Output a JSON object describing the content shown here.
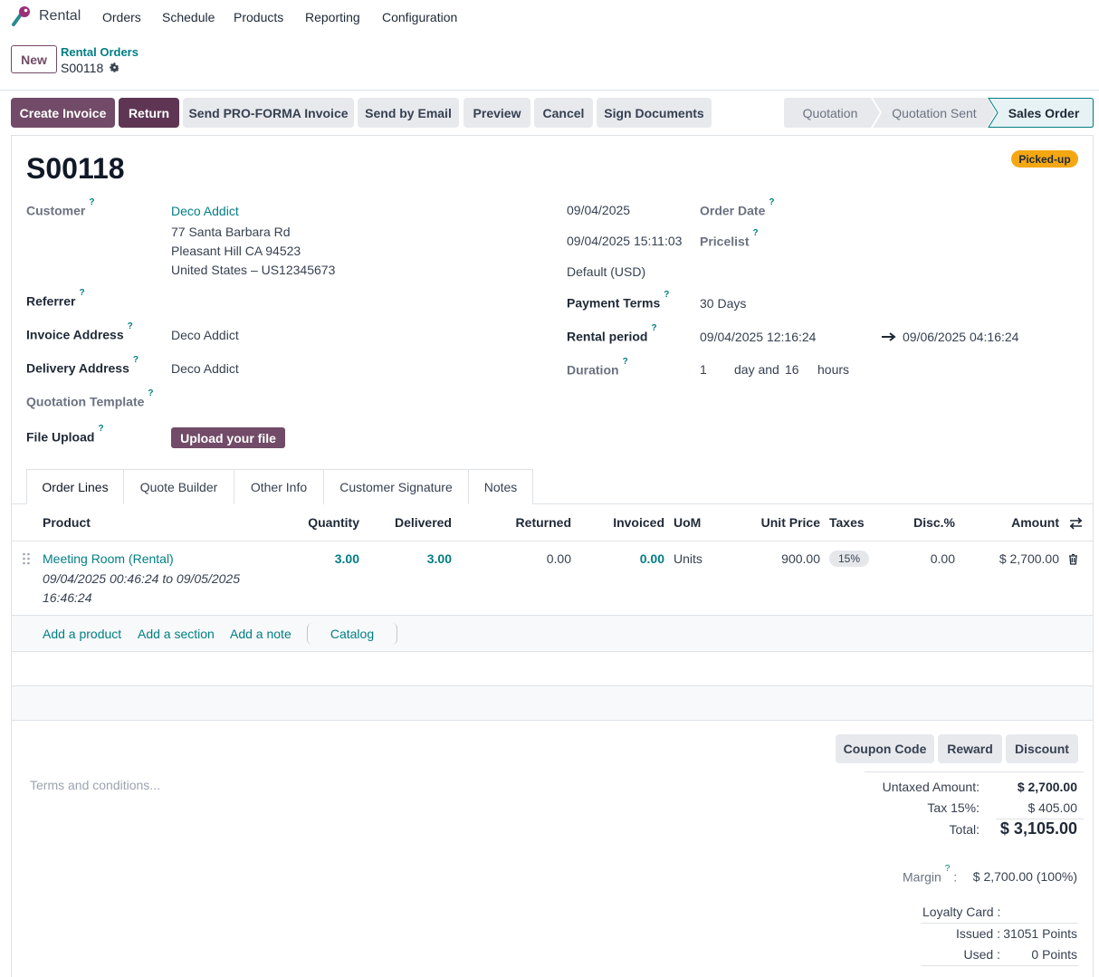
{
  "navbar": {
    "app_name": "Rental",
    "menu": [
      "Orders",
      "Schedule",
      "Products",
      "Reporting",
      "Configuration"
    ]
  },
  "control_panel": {
    "new_label": "New",
    "breadcrumb_parent": "Rental Orders",
    "breadcrumb_current": "S00118"
  },
  "actions": {
    "create_invoice": "Create Invoice",
    "return": "Return",
    "send_proforma": "Send PRO-FORMA Invoice",
    "send_email": "Send by Email",
    "preview": "Preview",
    "cancel": "Cancel",
    "sign_documents": "Sign Documents"
  },
  "status_bar": {
    "stages": [
      "Quotation",
      "Quotation Sent",
      "Sales Order"
    ],
    "active": "Sales Order"
  },
  "form": {
    "title": "S00118",
    "badge": "Picked-up",
    "customer_label": "Customer",
    "customer_name": "Deco Addict",
    "address_line1": "77 Santa Barbara Rd",
    "address_line2": "Pleasant Hill CA 94523",
    "address_line3": "United States – US12345673",
    "referrer_label": "Referrer",
    "invoice_address_label": "Invoice Address",
    "invoice_address": "Deco Addict",
    "delivery_address_label": "Delivery Address",
    "delivery_address": "Deco Addict",
    "quotation_template_label": "Quotation Template",
    "file_upload_label": "File Upload",
    "upload_button": "Upload your file",
    "date_value": "09/04/2025",
    "order_date_label": "Order Date",
    "datetime_value": "09/04/2025 15:11:03",
    "pricelist_label": "Pricelist",
    "pricelist_value": "Default (USD)",
    "payment_terms_label": "Payment Terms",
    "payment_terms": "30 Days",
    "rental_period_label": "Rental period",
    "rental_start": "09/04/2025 12:16:24",
    "rental_end": "09/06/2025 04:16:24",
    "duration_label": "Duration",
    "duration_days": "1",
    "duration_day_unit": "day and",
    "duration_hours": "16",
    "duration_hour_unit": "hours"
  },
  "tabs": [
    "Order Lines",
    "Quote Builder",
    "Other Info",
    "Customer Signature",
    "Notes"
  ],
  "table": {
    "headers": {
      "product": "Product",
      "quantity": "Quantity",
      "delivered": "Delivered",
      "returned": "Returned",
      "invoiced": "Invoiced",
      "uom": "UoM",
      "unit_price": "Unit Price",
      "taxes": "Taxes",
      "disc": "Disc.%",
      "amount": "Amount"
    },
    "rows": [
      {
        "product": "Meeting Room (Rental)",
        "period_line1": "09/04/2025 00:46:24 to 09/05/2025",
        "period_line2": "16:46:24",
        "quantity": "3.00",
        "delivered": "3.00",
        "returned": "0.00",
        "invoiced": "0.00",
        "uom": "Units",
        "unit_price": "900.00",
        "taxes": "15%",
        "disc": "0.00",
        "amount": "$ 2,700.00"
      }
    ],
    "add_product": "Add a product",
    "add_section": "Add a section",
    "add_note": "Add a note",
    "catalog": "Catalog"
  },
  "footer": {
    "terms_placeholder": "Terms and conditions...",
    "coupon_code": "Coupon Code",
    "reward": "Reward",
    "discount": "Discount",
    "untaxed_label": "Untaxed Amount:",
    "untaxed_value": "$ 2,700.00",
    "tax_label": "Tax 15%:",
    "tax_value": "$ 405.00",
    "total_label": "Total:",
    "total_value": "$ 3,105.00",
    "margin_label": "Margin",
    "margin_value": "$ 2,700.00 (100%)",
    "loyalty_label": "Loyalty Card :",
    "issued_label": "Issued :",
    "issued_value": "31051 Points",
    "used_label": "Used :",
    "used_value": "0 Points"
  },
  "colors": {
    "brand": "#714b67",
    "accent": "#017e84",
    "badge": "#f3a712"
  }
}
